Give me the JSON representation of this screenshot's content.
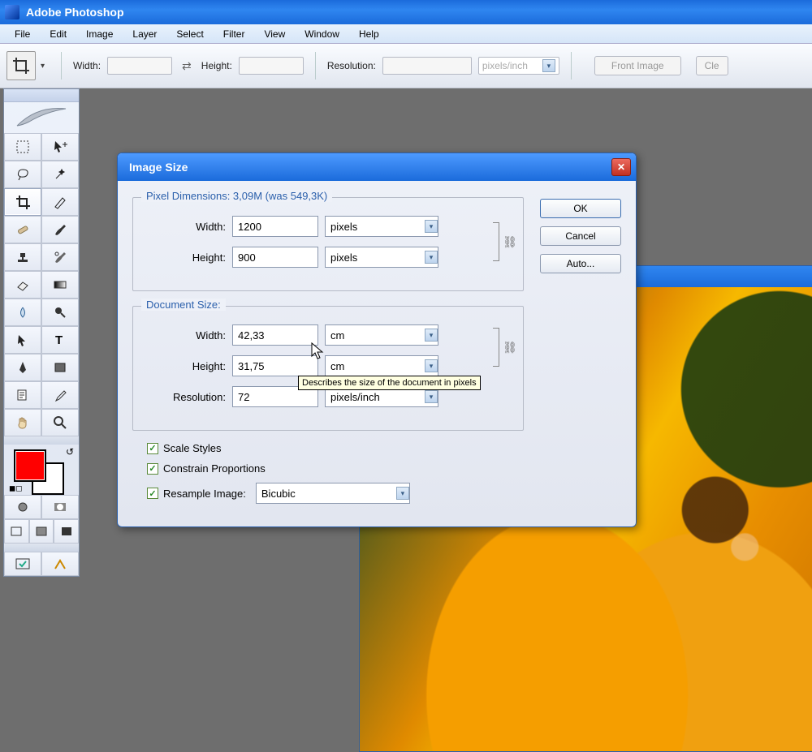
{
  "app": {
    "title": "Adobe Photoshop"
  },
  "menus": [
    "File",
    "Edit",
    "Image",
    "Layer",
    "Select",
    "Filter",
    "View",
    "Window",
    "Help"
  ],
  "options": {
    "width_label": "Width:",
    "height_label": "Height:",
    "resolution_label": "Resolution:",
    "res_unit": "pixels/inch",
    "front_image": "Front Image",
    "clear": "Cle"
  },
  "tools": {
    "row1a": "marquee",
    "row1b": "move",
    "row2a": "lasso",
    "row2b": "wand",
    "row3a": "crop",
    "row3b": "slice",
    "row4a": "heal",
    "row4b": "brush",
    "row5a": "stamp",
    "row5b": "history",
    "row6a": "eraser",
    "row6b": "gradient",
    "row7a": "blur",
    "row7b": "dodge",
    "row8a": "path-sel",
    "row8b": "type",
    "row9a": "pen",
    "row9b": "shape",
    "row10a": "notes",
    "row10b": "eyedrop",
    "row11a": "hand",
    "row11b": "zoom",
    "jump1": "imageready",
    "jump2": "bridge"
  },
  "dialog": {
    "title": "Image Size",
    "ok": "OK",
    "cancel": "Cancel",
    "auto": "Auto...",
    "pixel_legend": "Pixel Dimensions:  3,09M (was 549,3K)",
    "px_width_label": "Width:",
    "px_width_value": "1200",
    "px_width_unit": "pixels",
    "px_height_label": "Height:",
    "px_height_value": "900",
    "px_height_unit": "pixels",
    "doc_legend": "Document Size:",
    "doc_width_label": "Width:",
    "doc_width_value": "42,33",
    "doc_width_unit": "cm",
    "doc_height_label": "Height:",
    "doc_height_value": "31,75",
    "doc_height_unit": "cm",
    "doc_res_label": "Resolution:",
    "doc_res_value": "72",
    "doc_res_unit": "pixels/inch",
    "scale_styles": "Scale Styles",
    "constrain": "Constrain Proportions",
    "resample": "Resample Image:",
    "resample_method": "Bicubic",
    "tooltip": "Describes the size of the document in pixels"
  }
}
